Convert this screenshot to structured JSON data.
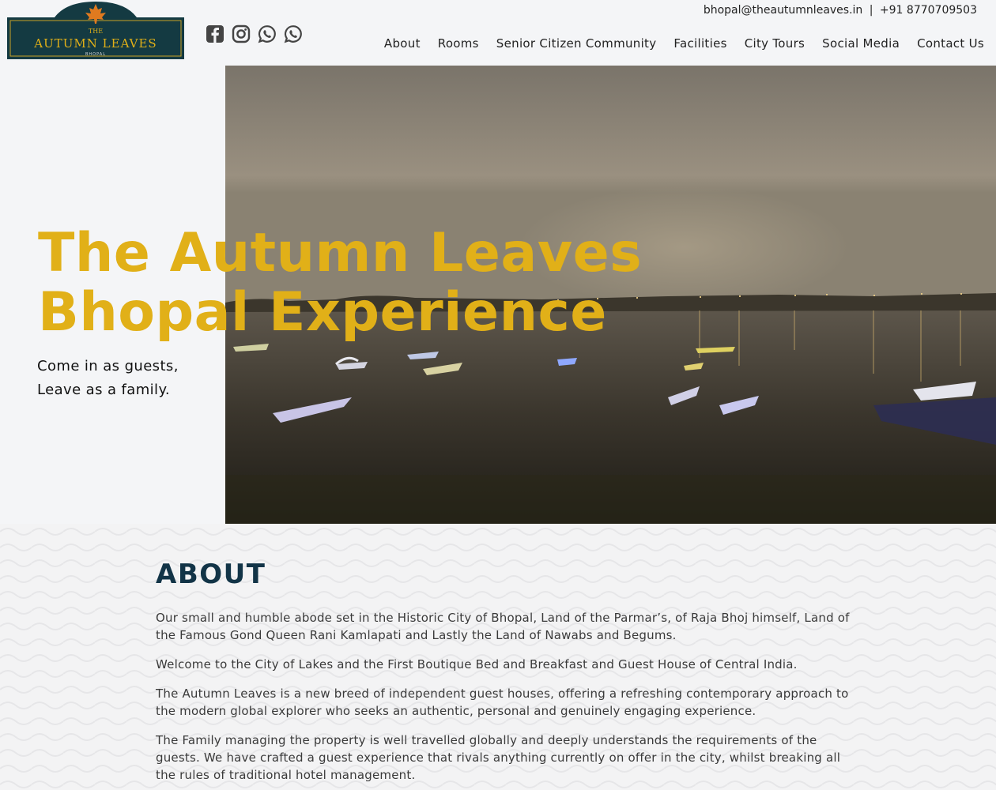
{
  "brand": {
    "logo_line1": "THE",
    "logo_line2": "AUTUMN LEAVES",
    "logo_line3": "BHOPAL",
    "colors": {
      "logo_bg": "#143a42",
      "gold": "#e1b018",
      "navy": "#123447"
    }
  },
  "header": {
    "email": "bhopal@theautumnleaves.in",
    "separator": "|",
    "phone": "+91 8770709503",
    "social_icons": [
      "facebook-icon",
      "instagram-icon",
      "whatsapp-icon",
      "whatsapp-icon"
    ]
  },
  "nav": {
    "items": [
      "About",
      "Rooms",
      "Senior Citizen Community",
      "Facilities",
      "City Tours",
      "Social Media",
      "Contact Us"
    ]
  },
  "hero": {
    "title_line1": "The Autumn Leaves",
    "title_line2": "Bhopal Experience",
    "sub_line1": "Come in as guests,",
    "sub_line2": "Leave as a family."
  },
  "about": {
    "heading": "ABOUT",
    "paragraphs": [
      "Our small and humble abode set in the Historic City of Bhopal, Land of the Parmar’s, of Raja Bhoj himself, Land of the Famous Gond Queen Rani Kamlapati and Lastly the Land of Nawabs and Begums.",
      "Welcome to the City of Lakes and the First Boutique Bed and Breakfast and Guest House of Central India.",
      "The Autumn Leaves is a new breed of independent guest houses, offering a refreshing contemporary approach to the modern global explorer who seeks an authentic, personal and genuinely engaging experience.",
      "The Family managing the property is well travelled globally and deeply understands the requirements of the guests. We have crafted a guest experience that rivals anything currently on offer in the city, whilst breaking all the rules of traditional hotel management."
    ]
  }
}
